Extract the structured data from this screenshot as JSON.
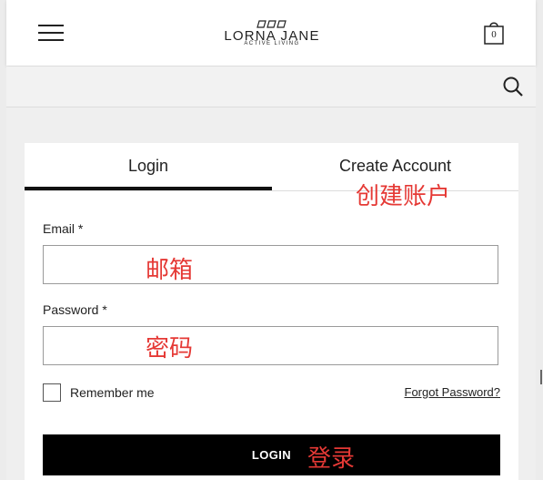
{
  "header": {
    "logo": {
      "name": "LORNA JANE",
      "tagline": "ACTIVE LIVING"
    },
    "cart": {
      "count": "0"
    },
    "menu_icon": "hamburger-menu-icon",
    "cart_icon": "shopping-bag-icon"
  },
  "search": {
    "icon": "search-icon"
  },
  "tabs": [
    {
      "label": "Login",
      "active": true
    },
    {
      "label": "Create Account",
      "active": false
    }
  ],
  "form": {
    "email": {
      "label": "Email *",
      "value": ""
    },
    "password": {
      "label": "Password *",
      "value": ""
    },
    "remember": {
      "label": "Remember me",
      "checked": false
    },
    "forgot_link": "Forgot Password?",
    "submit_label": "LOGIN"
  },
  "annotations": {
    "create_account": "创建账户",
    "email": "邮箱",
    "password": "密码",
    "login": "登录"
  },
  "colors": {
    "annotation": "#e53935",
    "button_bg": "#000000",
    "active_tab_border": "#111111"
  }
}
